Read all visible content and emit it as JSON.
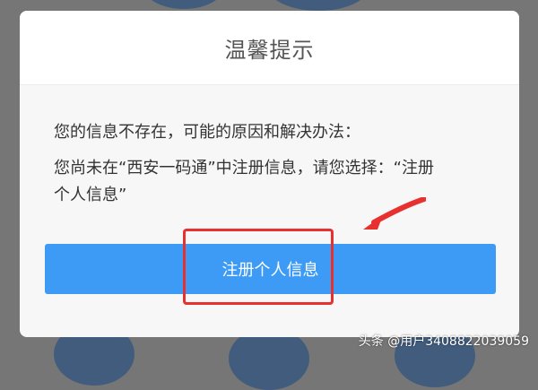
{
  "dialog": {
    "title": "温馨提示",
    "message_line1": "您的信息不存在，可能的原因和解决办法：",
    "message_line2": "您尚未在“西安一码通”中注册信息，请您选择：“注册个人信息”",
    "primary_button_label": "注册个人信息"
  },
  "annotation": {
    "highlight_color": "#e8312f",
    "arrow_color": "#e8312f"
  },
  "colors": {
    "button": "#3d9bf5",
    "overlay": "#767676"
  },
  "watermark": "头条 @用户3408822039059"
}
